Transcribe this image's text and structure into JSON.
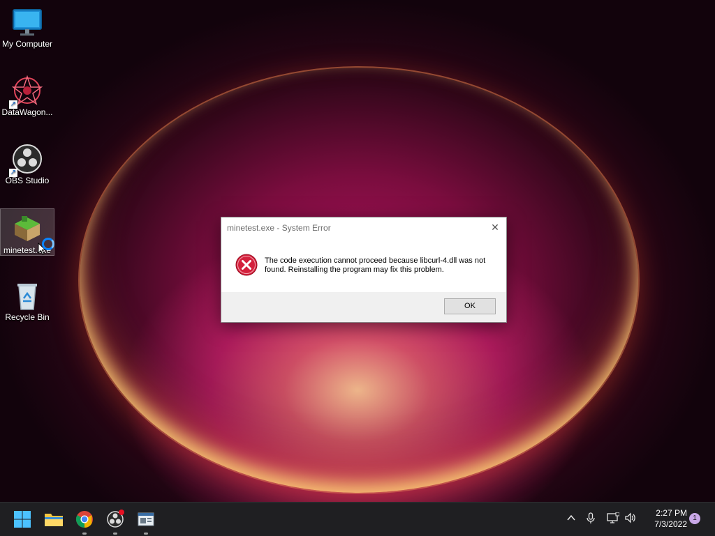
{
  "desktop": {
    "icons": [
      {
        "label": "My Computer",
        "icon": "monitor-icon",
        "shortcut": false
      },
      {
        "label": "DataWagon...",
        "icon": "datawagon-icon",
        "shortcut": true
      },
      {
        "label": "OBS Studio",
        "icon": "obs-icon",
        "shortcut": true
      },
      {
        "label": "minetest.exe",
        "icon": "minetest-icon",
        "shortcut": false,
        "selected": true
      },
      {
        "label": "Recycle Bin",
        "icon": "recycle-bin-icon",
        "shortcut": false
      }
    ]
  },
  "dialog": {
    "title": "minetest.exe - System Error",
    "message": "The code execution cannot proceed because libcurl-4.dll was not found. Reinstalling the program may fix this problem.",
    "ok_label": "OK",
    "close_glyph": "✕",
    "icon": "error-icon"
  },
  "taskbar": {
    "apps": [
      "start-icon",
      "file-explorer-icon",
      "chrome-icon",
      "obs-icon",
      "app-window-icon"
    ],
    "tray_icons": [
      "chevron-up-icon",
      "microphone-icon",
      "network-icon",
      "volume-icon"
    ],
    "time": "2:27 PM",
    "date": "7/3/2022",
    "notification_count": "1"
  },
  "colors": {
    "accent_blue": "#0a84ff",
    "error_red": "#d4213d",
    "taskbar_bg": "#1f1f22"
  }
}
